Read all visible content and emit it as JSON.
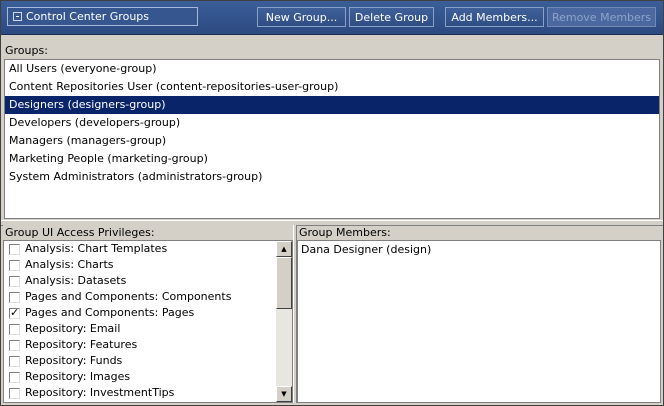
{
  "toolbar": {
    "selector_label": "Control Center Groups",
    "new_group": "New Group...",
    "delete_group": "Delete Group",
    "add_members": "Add Members...",
    "remove_members": "Remove Members"
  },
  "groups": {
    "label": "Groups:",
    "items": [
      "All Users (everyone-group)",
      "Content Repositories User (content-repositories-user-group)",
      "Designers (designers-group)",
      "Developers (developers-group)",
      "Managers (managers-group)",
      "Marketing People (marketing-group)",
      "System Administrators (administrators-group)"
    ],
    "selected": "Designers (designers-group)"
  },
  "privileges": {
    "label": "Group UI Access Privileges:",
    "items": [
      {
        "label": "Analysis: Chart Templates",
        "checked": false
      },
      {
        "label": "Analysis: Charts",
        "checked": false
      },
      {
        "label": "Analysis: Datasets",
        "checked": false
      },
      {
        "label": "Pages and Components: Components",
        "checked": false
      },
      {
        "label": "Pages and Components: Pages",
        "checked": true
      },
      {
        "label": "Repository: Email",
        "checked": false
      },
      {
        "label": "Repository: Features",
        "checked": false
      },
      {
        "label": "Repository: Funds",
        "checked": false
      },
      {
        "label": "Repository: Images",
        "checked": false
      },
      {
        "label": "Repository: InvestmentTips",
        "checked": false
      }
    ]
  },
  "members": {
    "label": "Group Members:",
    "items": [
      "Dana Designer (design)"
    ]
  },
  "colors": {
    "toolbar": "#2c4a80",
    "selection": "#0a246a",
    "panel": "#d4d0c8"
  }
}
